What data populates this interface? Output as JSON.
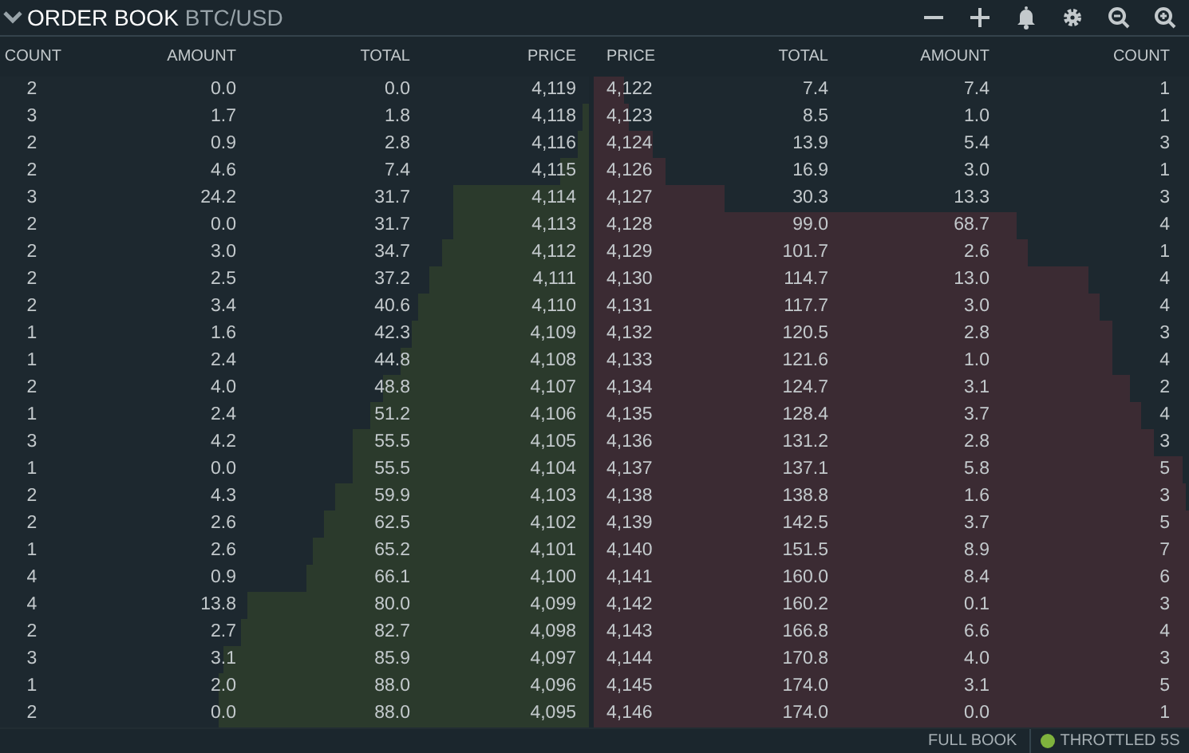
{
  "header": {
    "title": "ORDER BOOK",
    "pair": "BTC/USD"
  },
  "bids": {
    "columns": [
      "COUNT",
      "AMOUNT",
      "TOTAL",
      "PRICE"
    ],
    "rows": [
      {
        "count": "2",
        "amount": "0.0",
        "total": "0.0",
        "price": "4,119",
        "level": 0
      },
      {
        "count": "3",
        "amount": "1.7",
        "total": "1.8",
        "price": "4,118",
        "level": 0.01
      },
      {
        "count": "2",
        "amount": "0.9",
        "total": "2.8",
        "price": "4,116",
        "level": 0.02
      },
      {
        "count": "2",
        "amount": "4.6",
        "total": "7.4",
        "price": "4,115",
        "level": 0.05
      },
      {
        "count": "3",
        "amount": "24.2",
        "total": "31.7",
        "price": "4,114",
        "level": 0.23
      },
      {
        "count": "2",
        "amount": "0.0",
        "total": "31.7",
        "price": "4,113",
        "level": 0.23
      },
      {
        "count": "2",
        "amount": "3.0",
        "total": "34.7",
        "price": "4,112",
        "level": 0.25
      },
      {
        "count": "2",
        "amount": "2.5",
        "total": "37.2",
        "price": "4,111",
        "level": 0.27
      },
      {
        "count": "2",
        "amount": "3.4",
        "total": "40.6",
        "price": "4,110",
        "level": 0.29
      },
      {
        "count": "1",
        "amount": "1.6",
        "total": "42.3",
        "price": "4,109",
        "level": 0.3
      },
      {
        "count": "1",
        "amount": "2.4",
        "total": "44.8",
        "price": "4,108",
        "level": 0.32
      },
      {
        "count": "2",
        "amount": "4.0",
        "total": "48.8",
        "price": "4,107",
        "level": 0.35
      },
      {
        "count": "1",
        "amount": "2.4",
        "total": "51.2",
        "price": "4,106",
        "level": 0.37
      },
      {
        "count": "3",
        "amount": "4.2",
        "total": "55.5",
        "price": "4,105",
        "level": 0.4
      },
      {
        "count": "1",
        "amount": "0.0",
        "total": "55.5",
        "price": "4,104",
        "level": 0.4
      },
      {
        "count": "2",
        "amount": "4.3",
        "total": "59.9",
        "price": "4,103",
        "level": 0.43
      },
      {
        "count": "2",
        "amount": "2.6",
        "total": "62.5",
        "price": "4,102",
        "level": 0.45
      },
      {
        "count": "1",
        "amount": "2.6",
        "total": "65.2",
        "price": "4,101",
        "level": 0.47
      },
      {
        "count": "4",
        "amount": "0.9",
        "total": "66.1",
        "price": "4,100",
        "level": 0.48
      },
      {
        "count": "4",
        "amount": "13.8",
        "total": "80.0",
        "price": "4,099",
        "level": 0.58
      },
      {
        "count": "2",
        "amount": "2.7",
        "total": "82.7",
        "price": "4,098",
        "level": 0.59
      },
      {
        "count": "3",
        "amount": "3.1",
        "total": "85.9",
        "price": "4,097",
        "level": 0.62
      },
      {
        "count": "1",
        "amount": "2.0",
        "total": "88.0",
        "price": "4,096",
        "level": 0.63
      },
      {
        "count": "2",
        "amount": "0.0",
        "total": "88.0",
        "price": "4,095",
        "level": 0.63
      }
    ]
  },
  "asks": {
    "columns": [
      "PRICE",
      "TOTAL",
      "AMOUNT",
      "COUNT"
    ],
    "rows": [
      {
        "price": "4,122",
        "total": "7.4",
        "amount": "7.4",
        "count": "1",
        "level": 0.05
      },
      {
        "price": "4,123",
        "total": "8.5",
        "amount": "1.0",
        "count": "1",
        "level": 0.06
      },
      {
        "price": "4,124",
        "total": "13.9",
        "amount": "5.4",
        "count": "3",
        "level": 0.1
      },
      {
        "price": "4,126",
        "total": "16.9",
        "amount": "3.0",
        "count": "1",
        "level": 0.12
      },
      {
        "price": "4,127",
        "total": "30.3",
        "amount": "13.3",
        "count": "3",
        "level": 0.22
      },
      {
        "price": "4,128",
        "total": "99.0",
        "amount": "68.7",
        "count": "4",
        "level": 0.71
      },
      {
        "price": "4,129",
        "total": "101.7",
        "amount": "2.6",
        "count": "1",
        "level": 0.73
      },
      {
        "price": "4,130",
        "total": "114.7",
        "amount": "13.0",
        "count": "4",
        "level": 0.83
      },
      {
        "price": "4,131",
        "total": "117.7",
        "amount": "3.0",
        "count": "4",
        "level": 0.85
      },
      {
        "price": "4,132",
        "total": "120.5",
        "amount": "2.8",
        "count": "3",
        "level": 0.87
      },
      {
        "price": "4,133",
        "total": "121.6",
        "amount": "1.0",
        "count": "4",
        "level": 0.87
      },
      {
        "price": "4,134",
        "total": "124.7",
        "amount": "3.1",
        "count": "2",
        "level": 0.9
      },
      {
        "price": "4,135",
        "total": "128.4",
        "amount": "3.7",
        "count": "4",
        "level": 0.92
      },
      {
        "price": "4,136",
        "total": "131.2",
        "amount": "2.8",
        "count": "3",
        "level": 0.94
      },
      {
        "price": "4,137",
        "total": "137.1",
        "amount": "5.8",
        "count": "5",
        "level": 0.99
      },
      {
        "price": "4,138",
        "total": "138.8",
        "amount": "1.6",
        "count": "3",
        "level": 0.995
      },
      {
        "price": "4,139",
        "total": "142.5",
        "amount": "3.7",
        "count": "5",
        "level": 1
      },
      {
        "price": "4,140",
        "total": "151.5",
        "amount": "8.9",
        "count": "7",
        "level": 1
      },
      {
        "price": "4,141",
        "total": "160.0",
        "amount": "8.4",
        "count": "6",
        "level": 1
      },
      {
        "price": "4,142",
        "total": "160.2",
        "amount": "0.1",
        "count": "3",
        "level": 1
      },
      {
        "price": "4,143",
        "total": "166.8",
        "amount": "6.6",
        "count": "4",
        "level": 1
      },
      {
        "price": "4,144",
        "total": "170.8",
        "amount": "4.0",
        "count": "3",
        "level": 1
      },
      {
        "price": "4,145",
        "total": "174.0",
        "amount": "3.1",
        "count": "5",
        "level": 1
      },
      {
        "price": "4,146",
        "total": "174.0",
        "amount": "0.0",
        "count": "1",
        "level": 1
      }
    ]
  },
  "footer": {
    "full_book": "FULL BOOK",
    "throttle": "THROTTLED 5S"
  }
}
